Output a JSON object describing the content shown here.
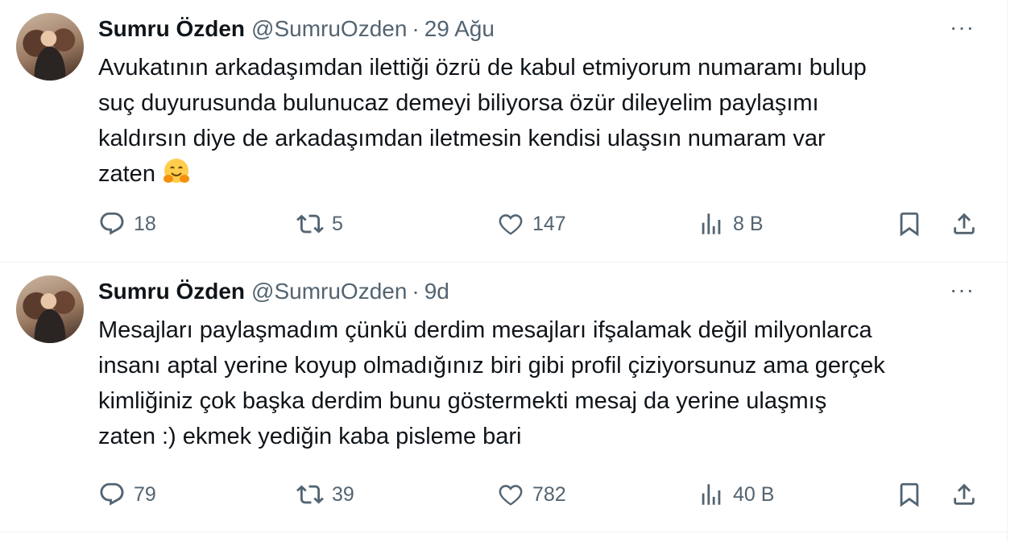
{
  "tweets": [
    {
      "name": "Sumru Özden",
      "handle": "@SumruOzden",
      "separator": "·",
      "time": "29 Ağu",
      "more": "···",
      "text": "Avukatının arkadaşımdan ilettiği özrü de kabul etmiyorum numaramı bulup\nsuç duyurusunda bulunucaz demeyi biliyorsa özür dileyelim paylaşımı\nkaldırsın diye de arkadaşımdan iletmesin kendisi ulaşsın numaram var\nzaten",
      "emoji": "hugging-face-emoji",
      "replies": "18",
      "reposts": "5",
      "likes": "147",
      "views": "8 B"
    },
    {
      "name": "Sumru Özden",
      "handle": "@SumruOzden",
      "separator": "·",
      "time": "9d",
      "more": "···",
      "text": "Mesajları paylaşmadım çünkü derdim mesajları ifşalamak değil milyonlarca\ninsanı aptal yerine koyup olmadığınız biri gibi profil çiziyorsunuz ama gerçek\nkimliğiniz çok başka derdim bunu göstermekti mesaj da yerine ulaşmış\nzaten :) ekmek yediğin kaba pisleme bari",
      "replies": "79",
      "reposts": "39",
      "likes": "782",
      "views": "40 B"
    }
  ],
  "icons": {
    "reply": "reply-icon",
    "repost": "repost-icon",
    "like": "heart-icon",
    "views": "views-icon",
    "bookmark": "bookmark-icon",
    "share": "share-icon"
  },
  "colors": {
    "text": "#0f1419",
    "secondary": "#536471",
    "border": "#eff3f4"
  }
}
